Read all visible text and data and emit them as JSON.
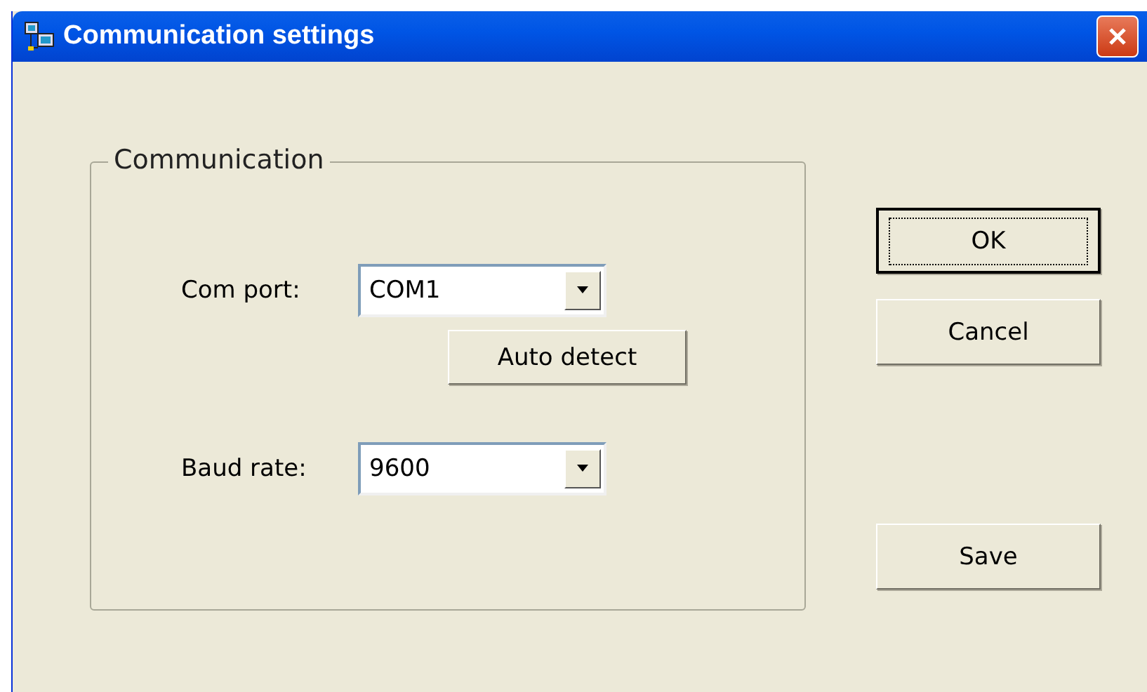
{
  "window": {
    "title": "Communication settings"
  },
  "group": {
    "title": "Communication",
    "com_port": {
      "label": "Com port:",
      "value": "COM1"
    },
    "auto_detect": {
      "label": "Auto detect"
    },
    "baud_rate": {
      "label": "Baud rate:",
      "value": "9600"
    }
  },
  "buttons": [
    {
      "label": "OK",
      "default": true
    },
    {
      "label": "Cancel",
      "default": false
    },
    {
      "label": "Save",
      "default": false
    }
  ]
}
